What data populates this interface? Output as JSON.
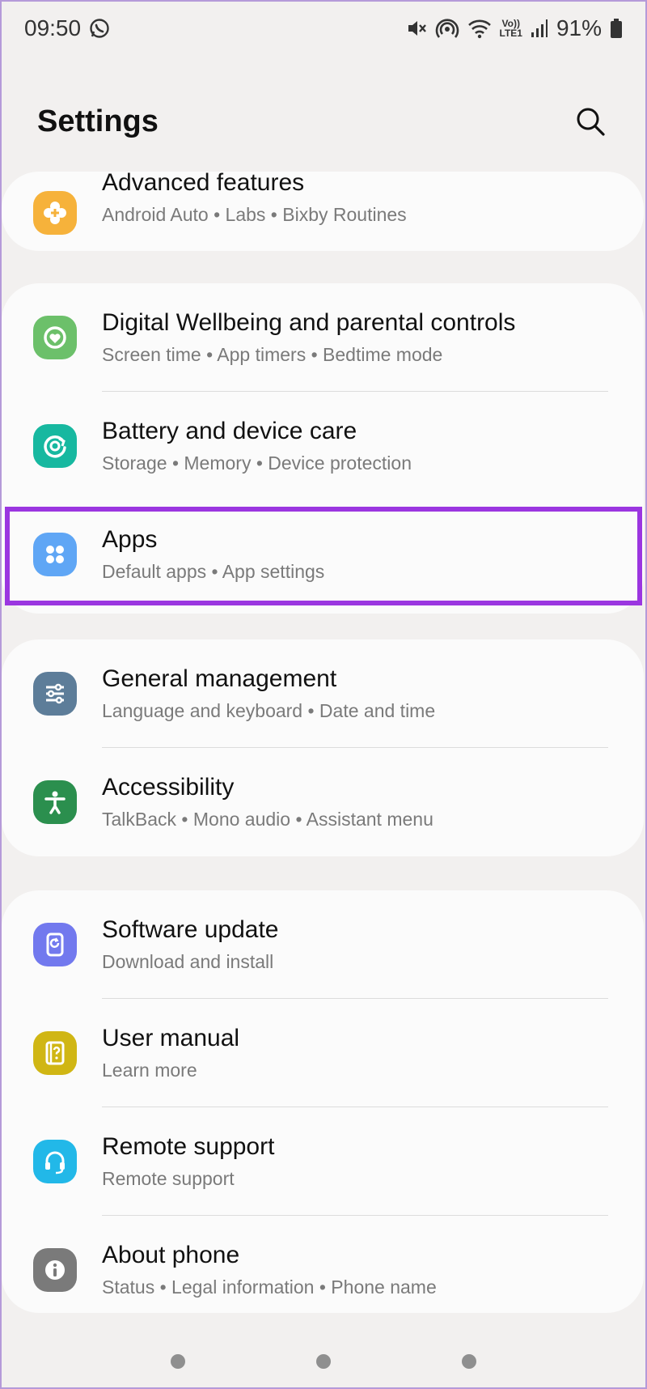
{
  "status": {
    "time": "09:50",
    "lte_top": "Vo))",
    "lte_bottom": "LTE1",
    "battery": "91%"
  },
  "header": {
    "title": "Settings",
    "search_icon": "search-icon"
  },
  "items": [
    {
      "title": "Advanced features",
      "subtitle": "Android Auto  •  Labs  •  Bixby Routines",
      "icon": "advanced-features-icon",
      "color": "#f6b23b"
    },
    {
      "title": "Digital Wellbeing and parental controls",
      "subtitle": "Screen time  •  App timers  •  Bedtime mode",
      "icon": "digital-wellbeing-icon",
      "color": "#6cc06a"
    },
    {
      "title": "Battery and device care",
      "subtitle": "Storage  •  Memory  •  Device protection",
      "icon": "device-care-icon",
      "color": "#17b8a0"
    },
    {
      "title": "Apps",
      "subtitle": "Default apps  •  App settings",
      "icon": "apps-icon",
      "color": "#5fa6f5"
    },
    {
      "title": "General management",
      "subtitle": "Language and keyboard  •  Date and time",
      "icon": "general-management-icon",
      "color": "#5d7d99"
    },
    {
      "title": "Accessibility",
      "subtitle": "TalkBack  •  Mono audio  •  Assistant menu",
      "icon": "accessibility-icon",
      "color": "#2b8f4e"
    },
    {
      "title": "Software update",
      "subtitle": "Download and install",
      "icon": "software-update-icon",
      "color": "#7279ee"
    },
    {
      "title": "User manual",
      "subtitle": "Learn more",
      "icon": "user-manual-icon",
      "color": "#d0b614"
    },
    {
      "title": "Remote support",
      "subtitle": "Remote support",
      "icon": "remote-support-icon",
      "color": "#22b8e8"
    },
    {
      "title": "About phone",
      "subtitle": "Status  •  Legal information  •  Phone name",
      "icon": "about-phone-icon",
      "color": "#7a7a7a"
    }
  ],
  "highlight_color": "#9b36e0",
  "nav": [
    "recents-button",
    "home-button",
    "back-button"
  ]
}
